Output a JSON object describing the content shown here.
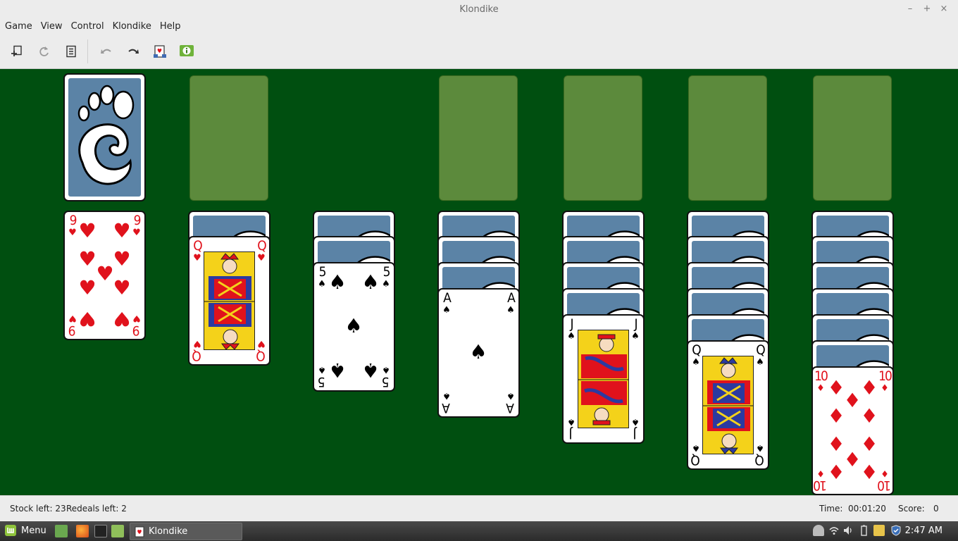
{
  "window": {
    "title": "Klondike"
  },
  "menu": [
    "Game",
    "View",
    "Control",
    "Klondike",
    "Help"
  ],
  "toolbar": {
    "buttons": [
      {
        "icon": "new-game-icon",
        "enabled": true
      },
      {
        "icon": "restart-icon",
        "enabled": false
      },
      {
        "icon": "select-game-icon",
        "enabled": true
      },
      {
        "icon": "undo-icon",
        "enabled": false
      },
      {
        "icon": "redo-icon",
        "enabled": true
      },
      {
        "icon": "deal-icon",
        "enabled": true
      },
      {
        "icon": "hint-icon",
        "enabled": true
      }
    ]
  },
  "board": {
    "stock": {
      "remaining": 23
    },
    "waste": {
      "cards": []
    },
    "foundations": [
      {
        "cards": []
      },
      {
        "cards": []
      },
      {
        "cards": []
      },
      {
        "cards": []
      }
    ],
    "tableau": [
      {
        "face_down": 0,
        "face_up": [
          {
            "rank": "9",
            "suit": "♥",
            "color": "red"
          }
        ]
      },
      {
        "face_down": 1,
        "face_up": [
          {
            "rank": "Q",
            "suit": "♥",
            "color": "red"
          }
        ]
      },
      {
        "face_down": 2,
        "face_up": [
          {
            "rank": "5",
            "suit": "♠",
            "color": "black"
          }
        ]
      },
      {
        "face_down": 3,
        "face_up": [
          {
            "rank": "A",
            "suit": "♠",
            "color": "black"
          }
        ]
      },
      {
        "face_down": 4,
        "face_up": [
          {
            "rank": "J",
            "suit": "♠",
            "color": "black"
          }
        ]
      },
      {
        "face_down": 5,
        "face_up": [
          {
            "rank": "Q",
            "suit": "♠",
            "color": "black"
          }
        ]
      },
      {
        "face_down": 6,
        "face_up": [
          {
            "rank": "10",
            "suit": "♦",
            "color": "red"
          }
        ]
      }
    ]
  },
  "status": {
    "stock_left": "Stock left: 23",
    "redeals_left": "Redeals left: 2",
    "time_label": "Time:",
    "time_value": "00:01:20",
    "score_label": "Score:",
    "score_value": "0"
  },
  "taskbar": {
    "menu_label": "Menu",
    "window_label": "Klondike",
    "clock": "2:47 AM"
  },
  "colors": {
    "felt": "#004f10",
    "empty_slot": "#5c8a3c",
    "card_back": "#5b83a6",
    "red_suit": "#e0121c"
  }
}
